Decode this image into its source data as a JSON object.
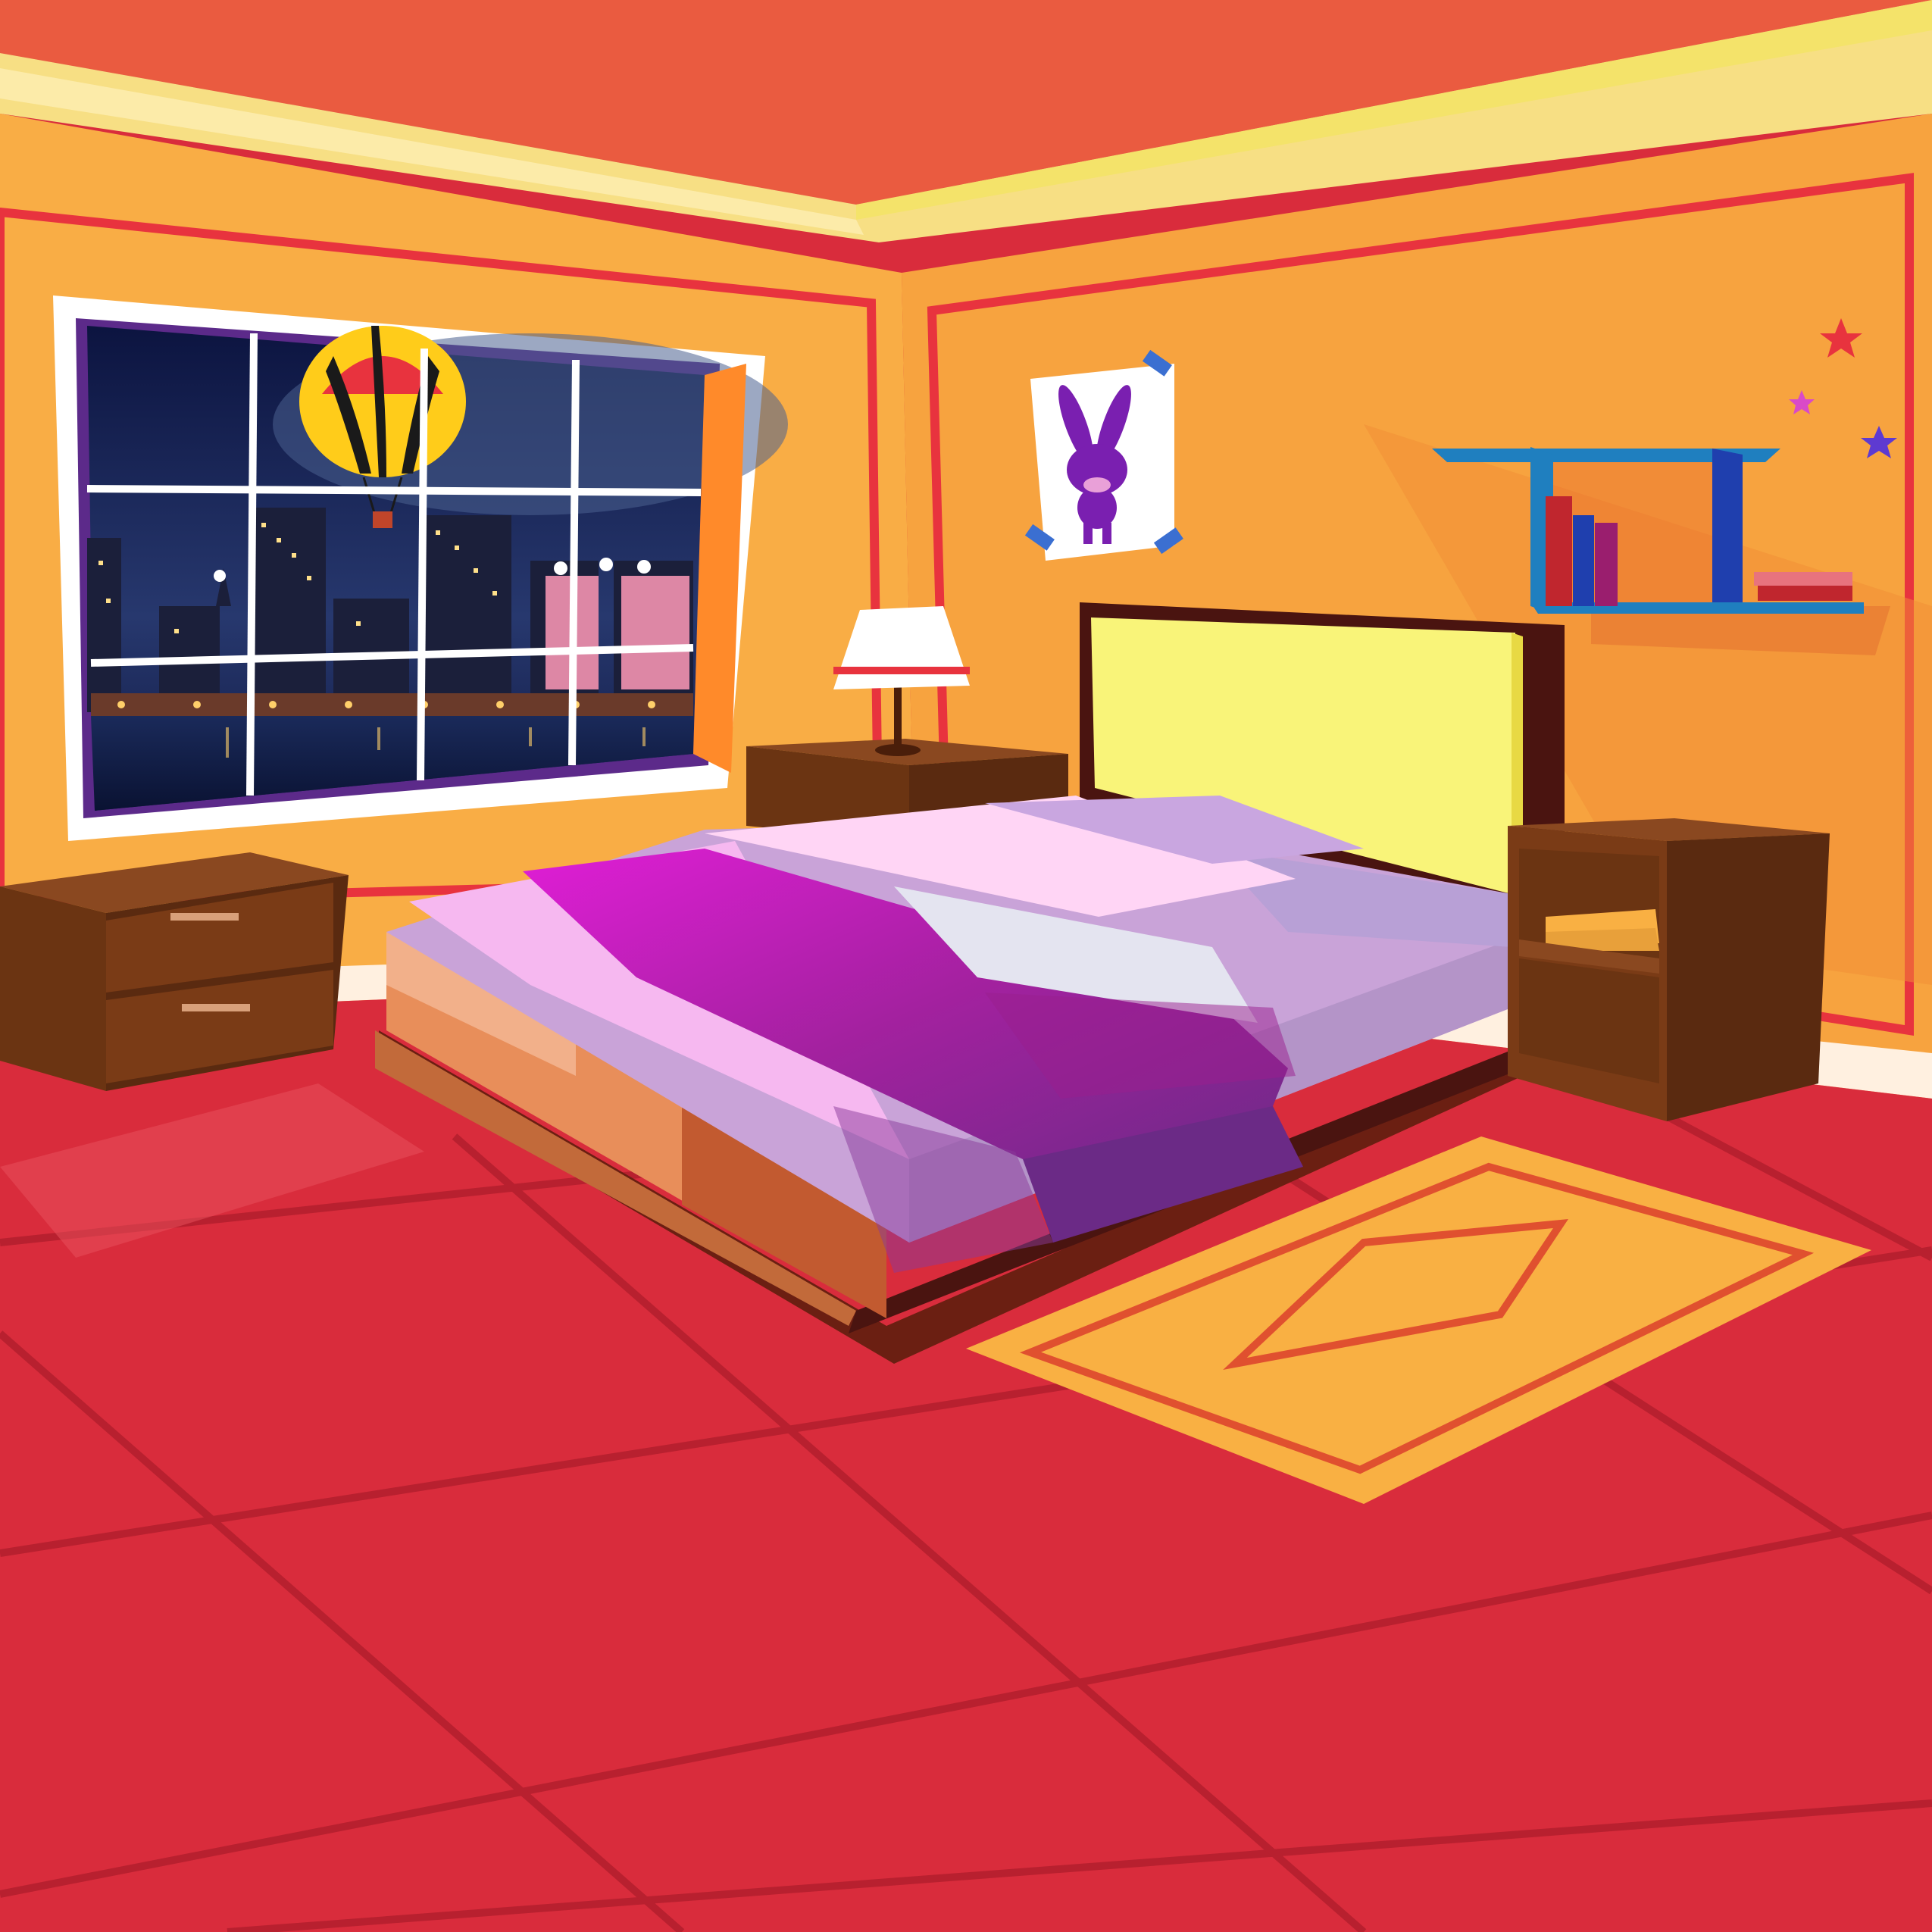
{
  "colors": {
    "ceiling": "#ea5b40",
    "ceiling_trim": "#f7df84",
    "wall_left": "#f9ad45",
    "wall_right": "#f7a33f",
    "wall_trim": "#e8333e",
    "floor": "#d92c3c",
    "floor_lines": "#b8202f",
    "wood_dark": "#5a2a10",
    "wood_mid": "#7a3b16",
    "headboard": "#f9f479",
    "sheet": "#f6b8f0",
    "blanket": "#b21aa6",
    "rug": "#f9b043",
    "rug_border": "#e0502f",
    "night_sky": "#1a2456",
    "shelf": "#1f7fbf"
  },
  "icons": [
    "hot-air-balloon-icon",
    "bunny-poster-icon",
    "star-icon"
  ]
}
